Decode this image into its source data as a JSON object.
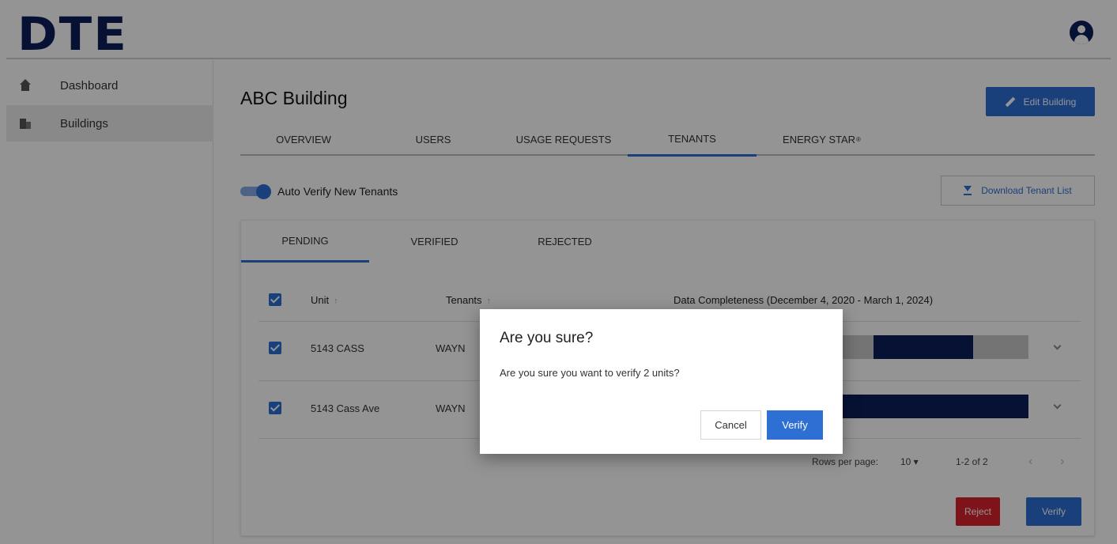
{
  "app": {
    "logo": "DTE"
  },
  "colors": {
    "brand_navy": "#0c1e5b",
    "accent_blue": "#2e6fd4",
    "reject_red": "#d9232e",
    "bar_gray": "#c8c8c8"
  },
  "sidebar": {
    "items": [
      {
        "label": "Dashboard",
        "icon": "home-icon",
        "active": false
      },
      {
        "label": "Buildings",
        "icon": "building-icon",
        "active": true
      }
    ]
  },
  "page": {
    "title": "ABC Building",
    "edit_button": "Edit Building",
    "tabs": [
      {
        "label": "OVERVIEW",
        "active": false
      },
      {
        "label": "USERS",
        "active": false
      },
      {
        "label": "USAGE REQUESTS",
        "active": false
      },
      {
        "label": "TENANTS",
        "active": true
      },
      {
        "label": "ENERGY STAR",
        "sup": "®",
        "active": false
      }
    ],
    "auto_verify_label": "Auto Verify New Tenants",
    "auto_verify_on": true,
    "download_button": "Download Tenant List"
  },
  "tenants": {
    "subtabs": [
      {
        "label": "PENDING",
        "active": true
      },
      {
        "label": "VERIFIED",
        "active": false
      },
      {
        "label": "REJECTED",
        "active": false
      }
    ],
    "columns": {
      "unit": "Unit",
      "tenants": "Tenants",
      "completeness": "Data Completeness (December 4, 2020 - March 1, 2024)"
    },
    "rows": [
      {
        "unit": "5143 CASS",
        "tenant": "WAYN",
        "checked": true
      },
      {
        "unit": "5143 Cass Ave",
        "tenant": "WAYN",
        "checked": true
      }
    ],
    "pagination": {
      "rows_per_page_label": "Rows per page:",
      "rows_per_page": "10 ▾",
      "range": "1-2 of 2",
      "prev": "‹",
      "next": "›"
    },
    "reject_button": "Reject",
    "verify_button": "Verify"
  },
  "dialog": {
    "title": "Are you sure?",
    "message": "Are you sure you want to verify 2 units?",
    "cancel": "Cancel",
    "confirm": "Verify"
  }
}
